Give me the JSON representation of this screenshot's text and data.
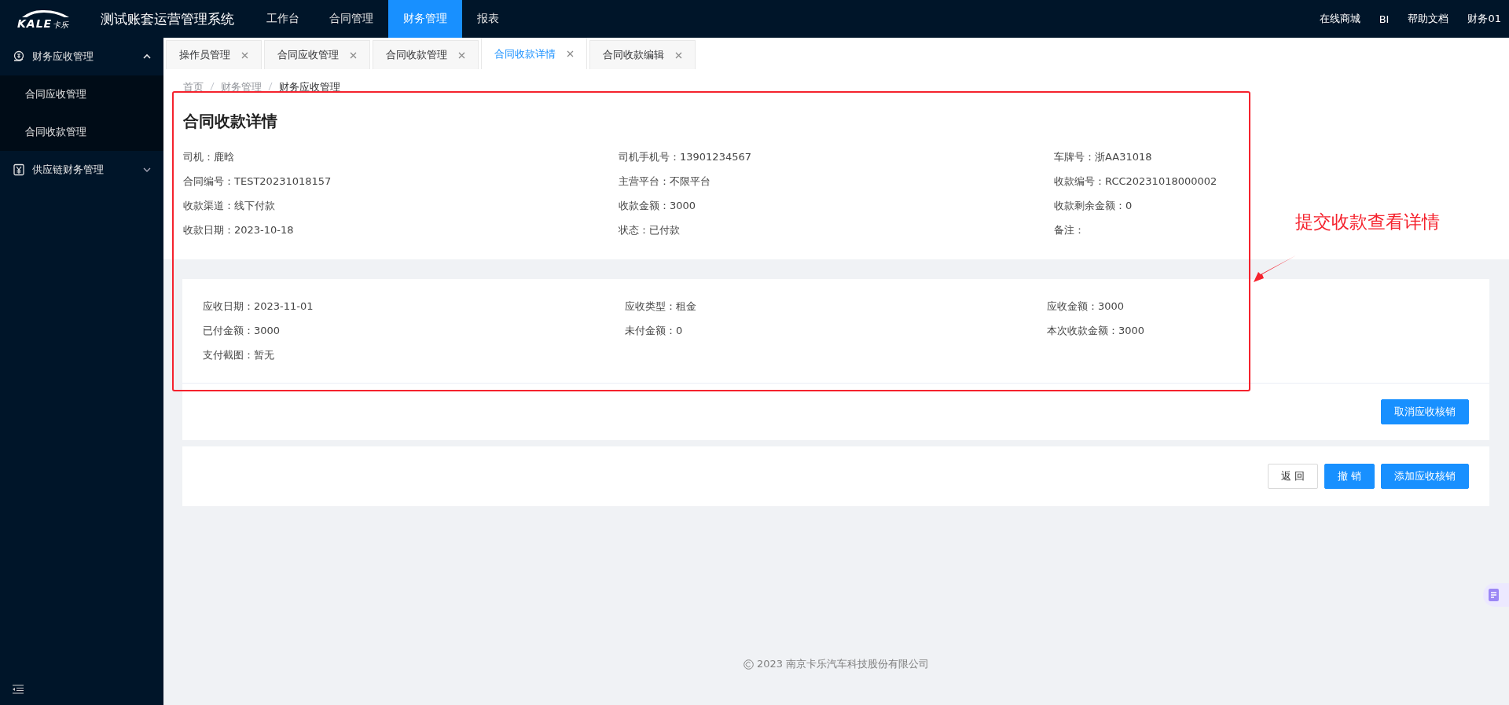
{
  "logo": {
    "mark": "KALE",
    "sub": "卡乐"
  },
  "app_title": "测试账套运营管理系统",
  "top_nav": [
    {
      "label": "工作台",
      "selected": false
    },
    {
      "label": "合同管理",
      "selected": false
    },
    {
      "label": "财务管理",
      "selected": true
    },
    {
      "label": "报表",
      "selected": false
    }
  ],
  "user_menu": [
    "在线商城",
    "BI",
    "帮助文档",
    "财务01"
  ],
  "sidebar": {
    "items": [
      {
        "label": "财务应收管理",
        "expanded": true,
        "children": [
          {
            "label": "合同应收管理"
          },
          {
            "label": "合同收款管理"
          }
        ]
      },
      {
        "label": "供应链财务管理",
        "expanded": false
      }
    ]
  },
  "tabs": [
    {
      "label": "操作员管理",
      "selected": false
    },
    {
      "label": "合同应收管理",
      "selected": false
    },
    {
      "label": "合同收款管理",
      "selected": false
    },
    {
      "label": "合同收款详情",
      "selected": true
    },
    {
      "label": "合同收款编辑",
      "selected": false
    }
  ],
  "breadcrumb": [
    "首页",
    "财务管理",
    "财务应收管理"
  ],
  "detail": {
    "title": "合同收款详情",
    "fields": [
      "司机：鹿晗",
      "司机手机号：13901234567",
      "车牌号：浙AA31018",
      "合同编号：TEST20231018157",
      "主营平台：不限平台",
      "收款编号：RCC20231018000002",
      "收款渠道：线下付款",
      "收款金额：3000",
      "收款剩余金额：0",
      "收款日期：2023-10-18",
      "状态：已付款",
      "备注："
    ]
  },
  "receivable": {
    "fields": [
      "应收日期：2023-11-01",
      "应收类型：租金",
      "应收金额：3000",
      "已付金额：3000",
      "未付金额：0",
      "本次收款金额：3000",
      "支付截图：暂无"
    ],
    "actions": [
      {
        "label": "取消应收核销",
        "kind": "primary"
      }
    ]
  },
  "actions": [
    {
      "label": "返 回",
      "kind": "default"
    },
    {
      "label": "撤 销",
      "kind": "primary"
    },
    {
      "label": "添加应收核销",
      "kind": "primary"
    }
  ],
  "footer": "2023 南京卡乐汽车科技股份有限公司",
  "annotation": {
    "text": "提交收款查看详情"
  }
}
